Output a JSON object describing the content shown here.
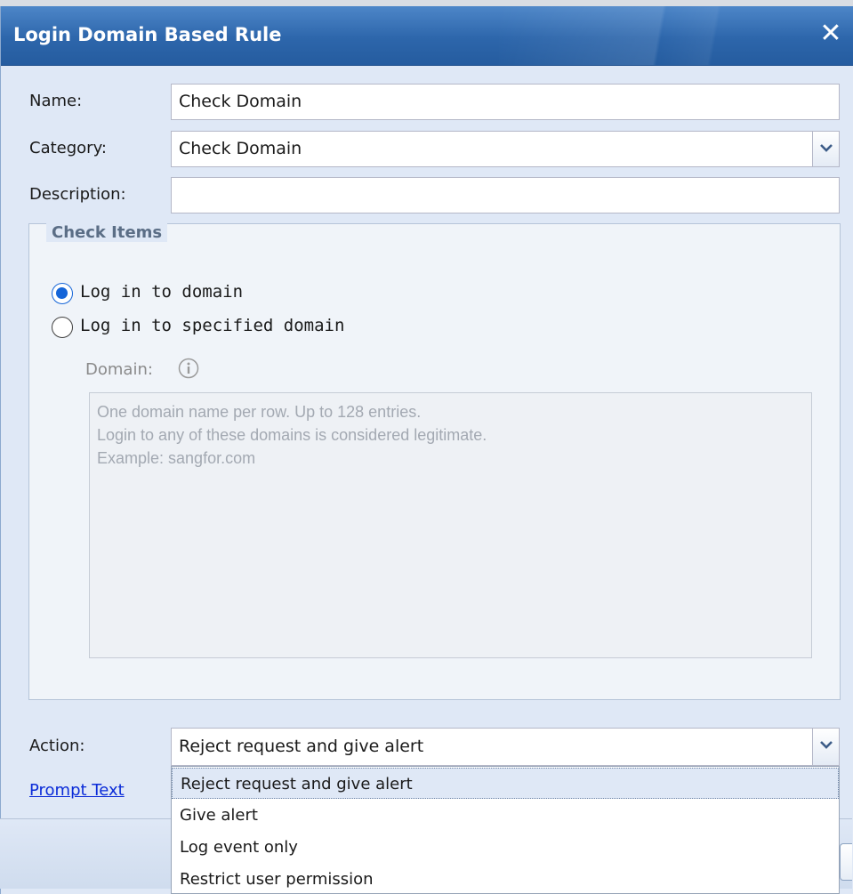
{
  "dialog": {
    "title": "Login Domain Based Rule",
    "close_symbol": "✕"
  },
  "form": {
    "name": {
      "label": "Name:",
      "value": "Check Domain"
    },
    "category": {
      "label": "Category:",
      "value": "Check Domain"
    },
    "description": {
      "label": "Description:",
      "value": ""
    }
  },
  "check_items": {
    "legend": "Check Items",
    "options": [
      {
        "label": "Log in to domain",
        "checked": true
      },
      {
        "label": "Log in to specified domain",
        "checked": false
      }
    ],
    "domain_label": "Domain:",
    "domain_placeholder_lines": [
      "One domain name per row. Up to 128 entries.",
      "Login to any of these domains is considered legitimate.",
      "Example: sangfor.com"
    ]
  },
  "action": {
    "label": "Action:",
    "value": "Reject request and give alert",
    "options": [
      "Reject request and give alert",
      "Give alert",
      "Log event only",
      "Restrict user permission"
    ]
  },
  "prompt_link": "Prompt Text",
  "colors": {
    "titlebar": "#2d66ab",
    "body": "#dfe8f6",
    "link": "#0a2bd8",
    "radio_checked": "#1565d8"
  },
  "icons": {
    "close": "close-icon",
    "combo_arrow": "chevron-down-icon",
    "info": "info-icon"
  }
}
